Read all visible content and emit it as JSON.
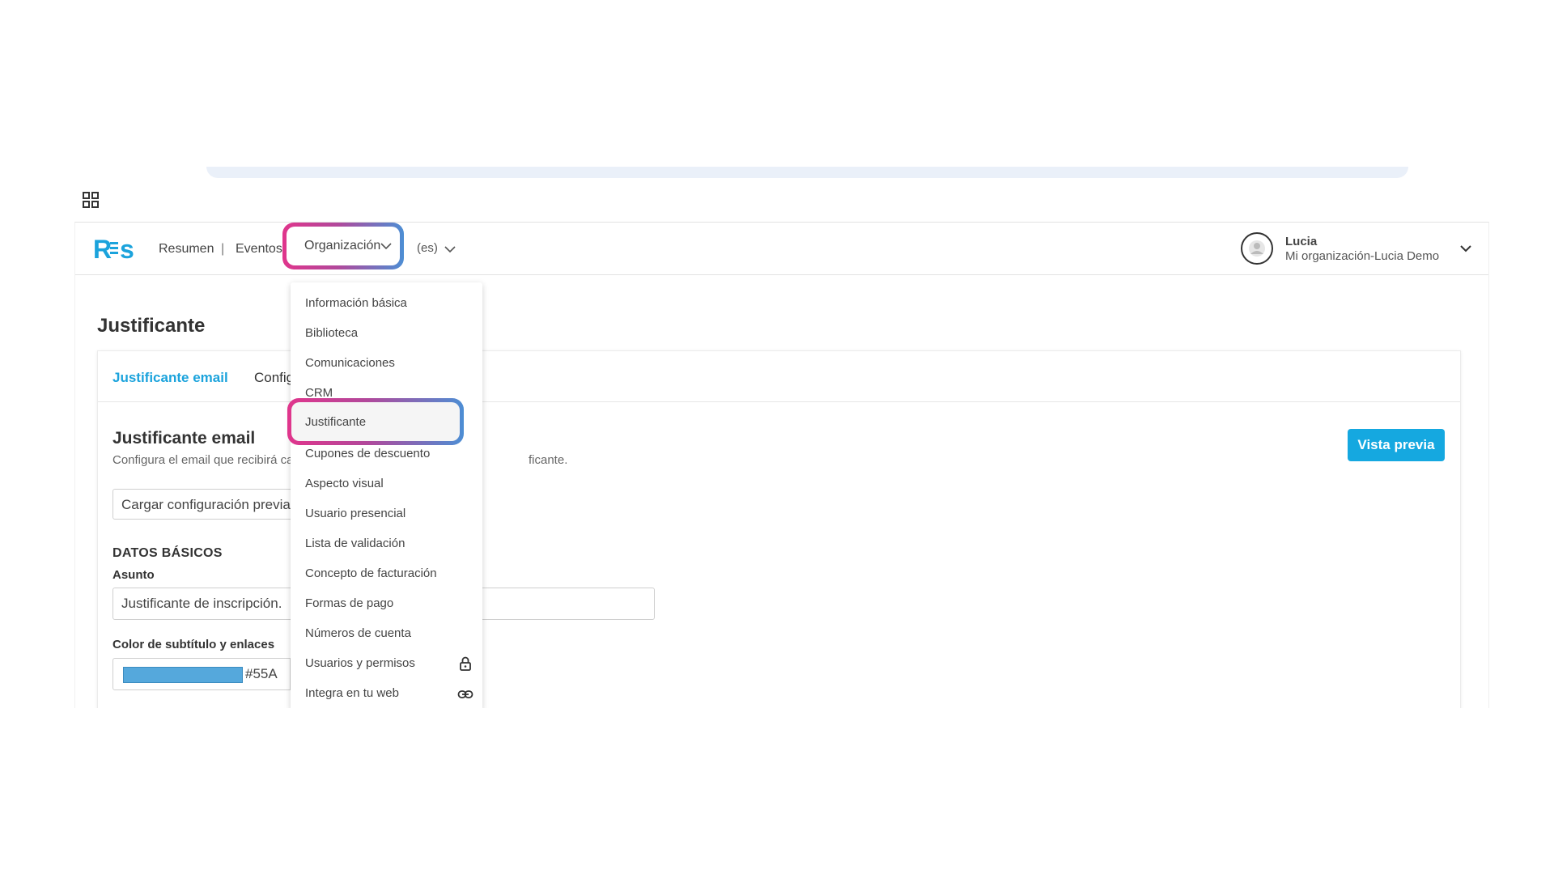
{
  "nav": {
    "logo": "RES",
    "items": [
      "Resumen",
      "Eventos"
    ],
    "separator": "|",
    "organization_label": "Organización",
    "language": "(es)"
  },
  "user": {
    "name": "Lucia",
    "organization": "Mi organización-Lucia Demo"
  },
  "page": {
    "title": "Justificante"
  },
  "tabs": {
    "active": "Justificante email",
    "second": "Config"
  },
  "section": {
    "title": "Justificante email",
    "description": "Configura el email que recibirá ca",
    "description_tail": "ficante.",
    "preview_button": "Vista previa"
  },
  "form": {
    "load_config": "Cargar configuración previa",
    "subheading": "DATOS BÁSICOS",
    "subject_label": "Asunto",
    "subject_value": "Justificante de inscripción.",
    "color_label": "Color de subtítulo y enlaces",
    "color_value": "#55A",
    "color_swatch": "#55a8dc"
  },
  "dropdown": {
    "items": [
      "Información básica",
      "Biblioteca",
      "Comunicaciones",
      "CRM",
      "Justificante",
      "Cupones de descuento",
      "Aspecto visual",
      "Usuario presencial",
      "Lista de validación",
      "Concepto de facturación",
      "Formas de pago",
      "Números de cuenta",
      "Usuarios y permisos",
      "Integra en tu web"
    ],
    "icons": {
      "users_permissions": "lock-icon",
      "integrate": "link-icon"
    }
  },
  "colors": {
    "accent": "#15a8e0",
    "highlight_pink": "#e0358c",
    "highlight_blue": "#4d8ed4"
  }
}
